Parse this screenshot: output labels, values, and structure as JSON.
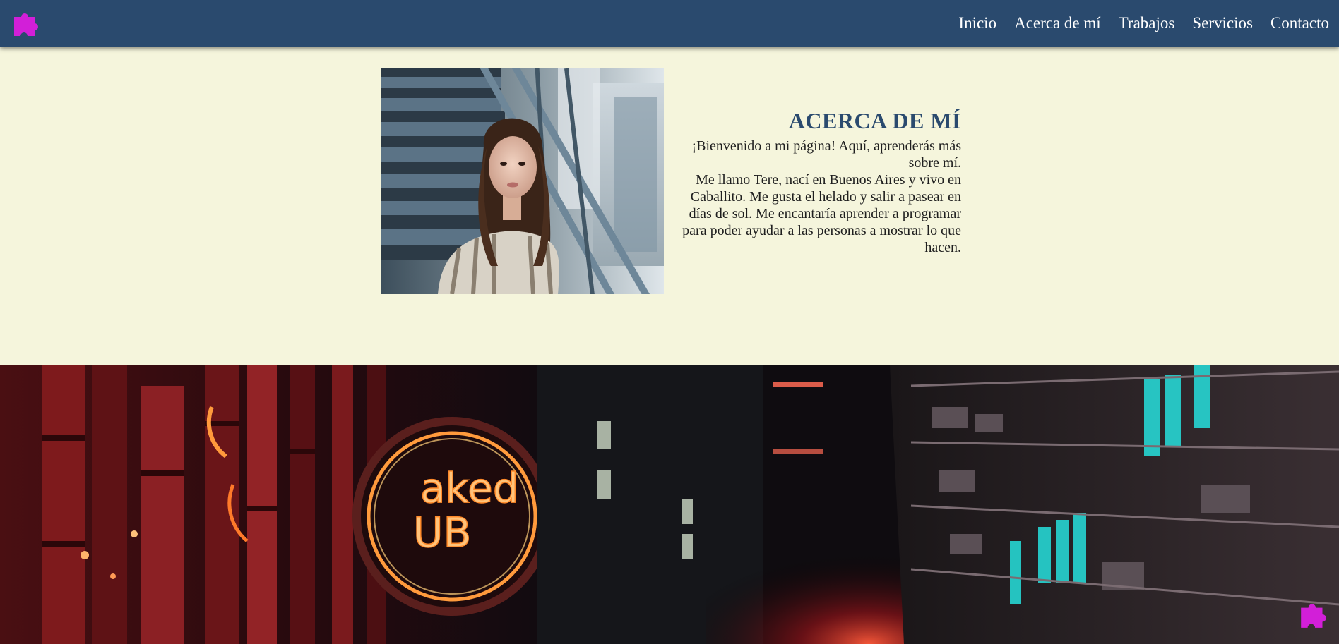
{
  "header": {
    "logo_icon": "puzzle-piece-icon",
    "logo_color": "#d21fd8",
    "background": "#2a4a6e",
    "nav": [
      {
        "label": "Inicio"
      },
      {
        "label": "Acerca de mí"
      },
      {
        "label": "Trabajos"
      },
      {
        "label": "Servicios"
      },
      {
        "label": "Contacto"
      }
    ]
  },
  "about": {
    "title": "ACERCA DE MÍ",
    "intro": "¡Bienvenido a mi página! Aquí, aprenderás más sobre mí.",
    "body": "Me llamo Tere, nací en Buenos Aires y vivo en Caballito. Me gusta el helado y salir a pasear en días de sol. Me encantaría aprender a programar para poder ayudar a las personas a mostrar lo que hacen.",
    "background": "#f5f5dc",
    "title_color": "#2a4a6e"
  },
  "banner": {
    "sign_text_line1": "aked",
    "sign_text_line2": "UB"
  },
  "floating_button": {
    "icon": "puzzle-piece-icon",
    "color": "#d21fd8"
  }
}
